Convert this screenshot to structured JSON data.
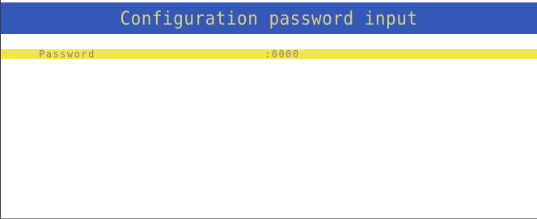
{
  "header": {
    "title": "Configuration password input"
  },
  "password_row": {
    "label": "Password",
    "value": ":0000"
  },
  "colors": {
    "title_bar": "#3457b8",
    "title_text": "#d9d27a",
    "row_highlight": "#f0e64a",
    "row_text": "#8d8670"
  }
}
